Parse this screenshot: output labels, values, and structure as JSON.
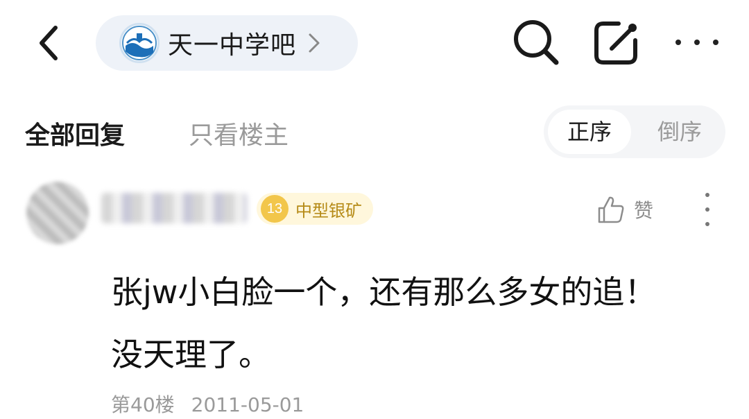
{
  "header": {
    "forum_name": "天一中学吧",
    "icons": {
      "back": "back-arrow-icon",
      "search": "search-icon",
      "edit": "edit-icon",
      "more": "more-horizontal-icon"
    }
  },
  "filter": {
    "tab_all": "全部回复",
    "tab_owner_only": "只看楼主",
    "sort_asc": "正序",
    "sort_desc": "倒序"
  },
  "post": {
    "username": "",
    "level": "13",
    "level_title": "中型银矿",
    "like_label": "赞",
    "content": "张jw小白脸一个，还有那么多女的追！没天理了。",
    "floor": "第40楼",
    "date": "2011-05-01"
  },
  "colors": {
    "accent_gold": "#f2c64b",
    "pill_bg": "#eef2f8",
    "muted_text": "#9a9a9a"
  }
}
